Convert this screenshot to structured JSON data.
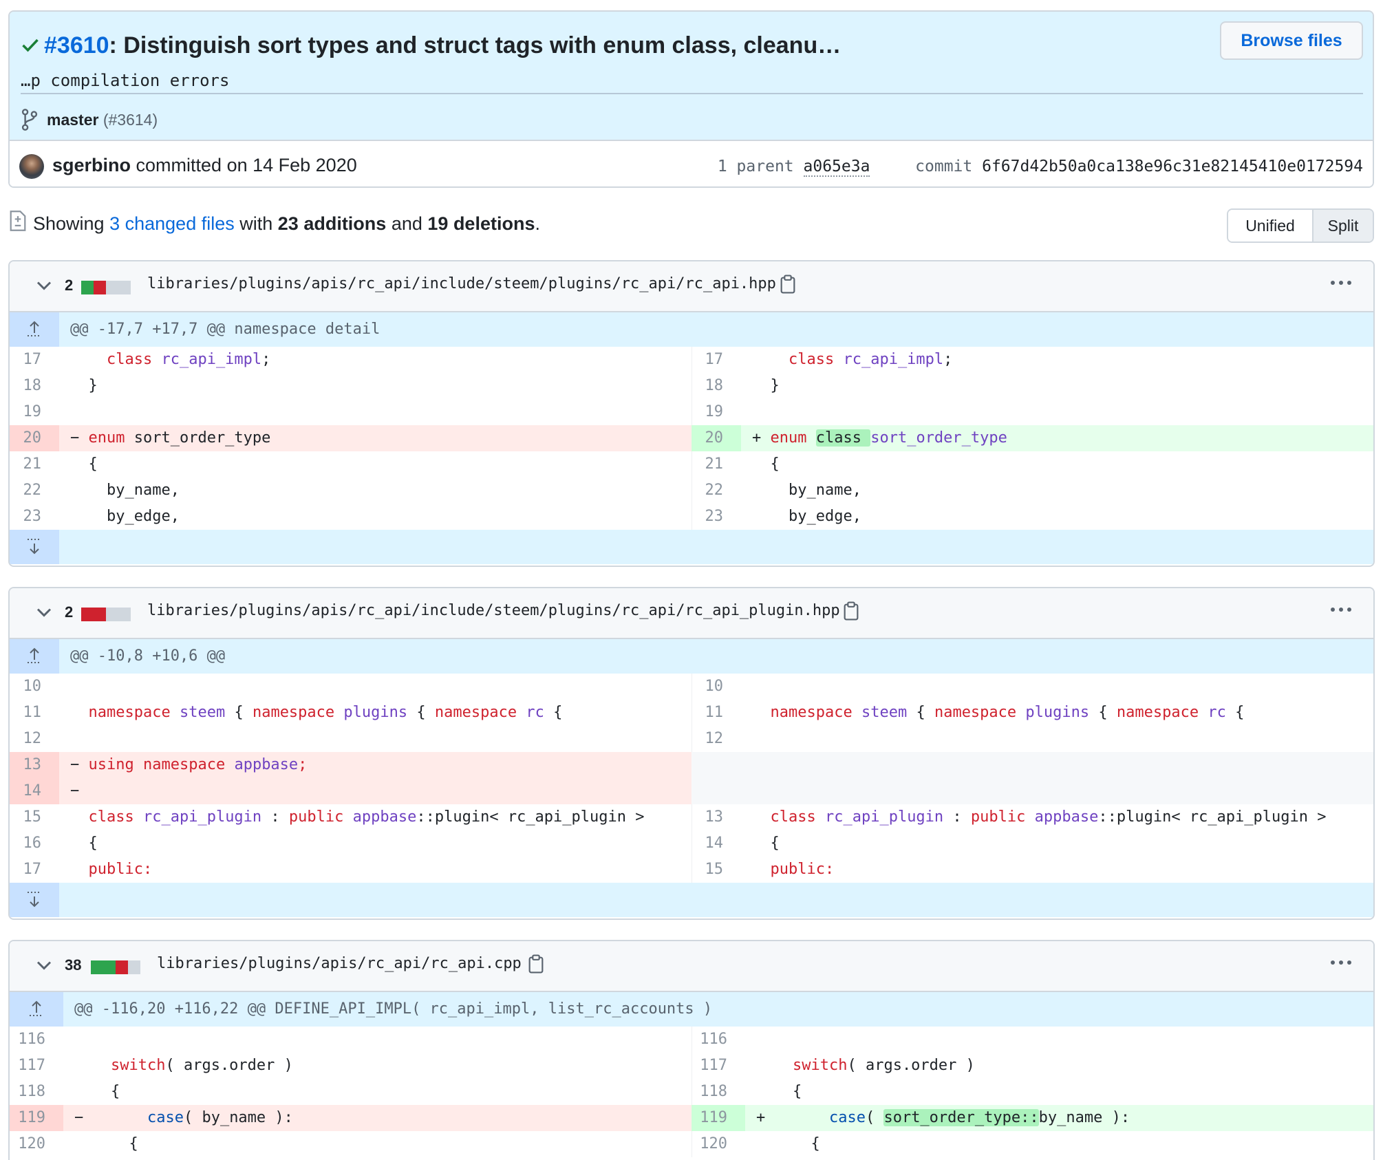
{
  "commit": {
    "pr_number": "#3610",
    "title_rest": ": Distinguish sort types and struct tags with enum class, cleanu…",
    "description": "…p compilation errors",
    "browse_files": "Browse files",
    "branch": "master",
    "branch_pr": "(#3614)",
    "author": "sgerbino",
    "committed_text": "committed on 14 Feb 2020",
    "parent_label": "1 parent",
    "parent_hash": "a065e3a",
    "commit_label": "commit",
    "commit_hash": "6f67d42b50a0ca138e96c31e82145410e0172594"
  },
  "stats": {
    "showing": "Showing",
    "changed_files": "3 changed files",
    "with": "with",
    "additions": "23 additions",
    "and": "and",
    "deletions": "19 deletions",
    "period": "."
  },
  "view": {
    "unified": "Unified",
    "split": "Split"
  },
  "files": [
    {
      "count": "2",
      "path": "libraries/plugins/apis/rc_api/include/steem/plugins/rc_api/rc_api.hpp",
      "hunk": "@@ -17,7 +17,7 @@ namespace detail",
      "rows": [
        {
          "l": "17",
          "r": "17"
        },
        {
          "l": "18",
          "r": "18"
        },
        {
          "l": "19",
          "r": "19"
        },
        {
          "l": "20",
          "r": "20",
          "l_sign": "−",
          "r_sign": "+"
        },
        {
          "l": "21",
          "r": "21"
        },
        {
          "l": "22",
          "r": "22"
        },
        {
          "l": "23",
          "r": "23"
        }
      ]
    },
    {
      "count": "2",
      "path": "libraries/plugins/apis/rc_api/include/steem/plugins/rc_api/rc_api_plugin.hpp",
      "hunk": "@@ -10,8 +10,6 @@",
      "rows": [
        {
          "l": "10",
          "r": "10"
        },
        {
          "l": "11",
          "r": "11"
        },
        {
          "l": "12",
          "r": "12"
        },
        {
          "l": "13",
          "r": "",
          "l_sign": "−"
        },
        {
          "l": "14",
          "r": "",
          "l_sign": "−"
        },
        {
          "l": "15",
          "r": "13"
        },
        {
          "l": "16",
          "r": "14"
        },
        {
          "l": "17",
          "r": "15"
        }
      ]
    },
    {
      "count": "38",
      "path": "libraries/plugins/apis/rc_api/rc_api.cpp",
      "hunk": "@@ -116,20 +116,22 @@ DEFINE_API_IMPL( rc_api_impl, list_rc_accounts )",
      "rows": [
        {
          "l": "116",
          "r": "116"
        },
        {
          "l": "117",
          "r": "117"
        },
        {
          "l": "118",
          "r": "118"
        },
        {
          "l": "119",
          "r": "119",
          "l_sign": "−",
          "r_sign": "+"
        },
        {
          "l": "120",
          "r": "120"
        }
      ]
    }
  ],
  "code": {
    "f1": {
      "class_kw": "class",
      "impl": "rc_api_impl",
      "semi": ";",
      "brace_close": "}",
      "enum_kw": "enum",
      "sort_order_type": "sort_order_type",
      "class_hl": "class",
      "brace_open": "{",
      "by_name": "by_name,",
      "by_edge": "by_edge,"
    },
    "f2": {
      "namespace_kw": "namespace",
      "steem": "steem",
      "plugins": "plugins",
      "rc": "rc",
      "brace_open": "{",
      "using_kw": "using",
      "appbase": "appbase",
      "semi": ";",
      "class_kw": "class",
      "rc_api_plugin": "rc_api_plugin",
      "colon": ":",
      "public_kw": "public",
      "plugin_tpl": "::plugin< rc_api_plugin >",
      "public_label": "public:"
    },
    "f3": {
      "switch_kw": "switch",
      "switch_rest": "( args.order )",
      "brace_open": "{",
      "case_kw": "case",
      "case_open": "( ",
      "by_name_rest": "by_name ):",
      "sort_scope": "sort_order_type::"
    }
  }
}
